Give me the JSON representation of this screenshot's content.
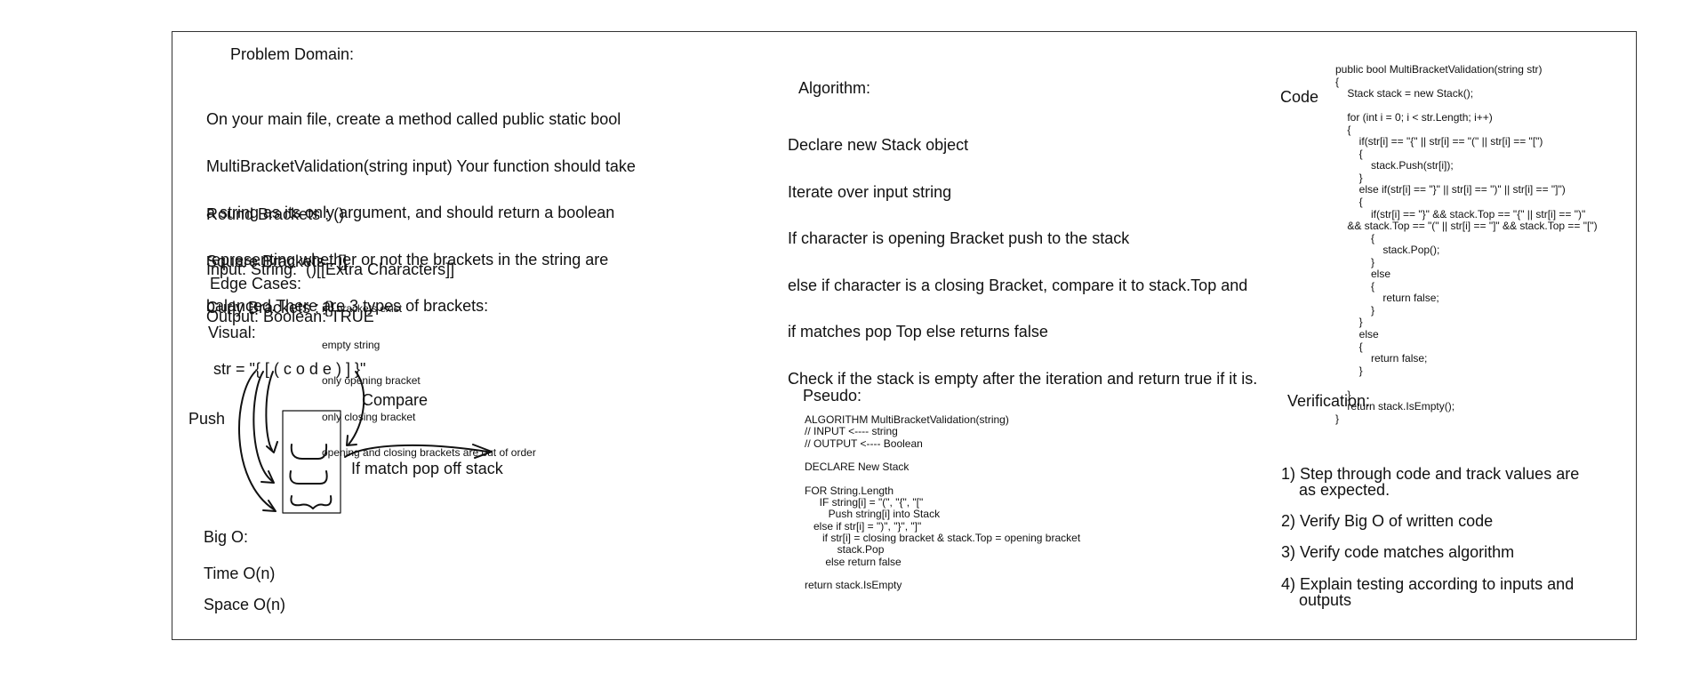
{
  "problem": {
    "heading": "Problem Domain:",
    "description": [
      "On your main file, create a method called public static bool",
      "MultiBracketValidation(string input) Your function should take",
      "a string as its only argument, and should return a boolean",
      "representing whether or not the brackets in the string are",
      "balanced.There are 3 types of brackets:"
    ],
    "bracket_types": [
      "Round Brackets : ()",
      "Square Brackets : []",
      "Curly Brackets : {}"
    ],
    "example": [
      "Input: String:  ()[[Extra Characters]]",
      "Output: Boolean: TRUE"
    ],
    "edge_heading": "Edge Cases:",
    "edge_cases": [
      "no brackets exist",
      "empty string",
      "only opening bracket",
      "only closing bracket",
      "opening and closing brackets are out of order"
    ],
    "visual_heading": "Visual:"
  },
  "visual": {
    "str_label": "str = \"{ [ ( c o d e ) ] }\"",
    "push_label": "Push",
    "compare_label": "Compare",
    "match_label": "If match pop off stack"
  },
  "bigo": {
    "heading": "Big O:",
    "time": "Time O(n)",
    "space": "Space O(n)"
  },
  "algorithm": {
    "heading": "Algorithm:",
    "steps": [
      "Declare new Stack object",
      "Iterate over input string",
      "If character is opening Bracket push to the stack",
      "else if character is a closing Bracket, compare it to stack.Top and",
      "if matches pop Top else returns false",
      "Check if the stack is empty after the iteration and return true if it is."
    ]
  },
  "pseudo": {
    "heading": "Pseudo:",
    "lines": [
      "ALGORITHM MultiBracketValidation(string)",
      "// INPUT <---- string",
      "// OUTPUT <---- Boolean",
      "",
      "DECLARE New Stack",
      "",
      "FOR String.Length",
      "     IF string[i] = \"(\", \"{\", \"[\"",
      "        Push string[i] into Stack",
      "   else if str[i] = \")\", \"}\", \"]\"",
      "      if str[i] = closing bracket & stack.Top = opening bracket",
      "           stack.Pop",
      "       else return false",
      "",
      "return stack.IsEmpty"
    ]
  },
  "code": {
    "heading": "Code",
    "lines": [
      "public bool MultiBracketValidation(string str)",
      "{",
      "    Stack stack = new Stack();",
      "",
      "    for (int i = 0; i < str.Length; i++)",
      "    {",
      "        if(str[i] == \"{\" || str[i] == \"(\" || str[i] == \"[\")",
      "        {",
      "            stack.Push(str[i]);",
      "        }",
      "        else if(str[i] == \"}\" || str[i] == \")\" || str[i] == \"]\")",
      "        {",
      "            if(str[i] == \"}\" && stack.Top == \"{\" || str[i] == \")\"",
      "    && stack.Top == \"(\" || str[i] == \"]\" && stack.Top == \"[\")",
      "            {",
      "                stack.Pop();",
      "            }",
      "            else",
      "            {",
      "                return false;",
      "            }",
      "        }",
      "        else",
      "        {",
      "            return false;",
      "        }",
      "",
      "    }",
      "    return stack.IsEmpty();",
      "}"
    ]
  },
  "verification": {
    "heading": "Verification:",
    "items": [
      "1) Step through code and track values are\n    as expected.",
      "2) Verify Big O of written code",
      "3) Verify code matches algorithm",
      "4) Explain testing according to inputs and\n    outputs"
    ]
  }
}
